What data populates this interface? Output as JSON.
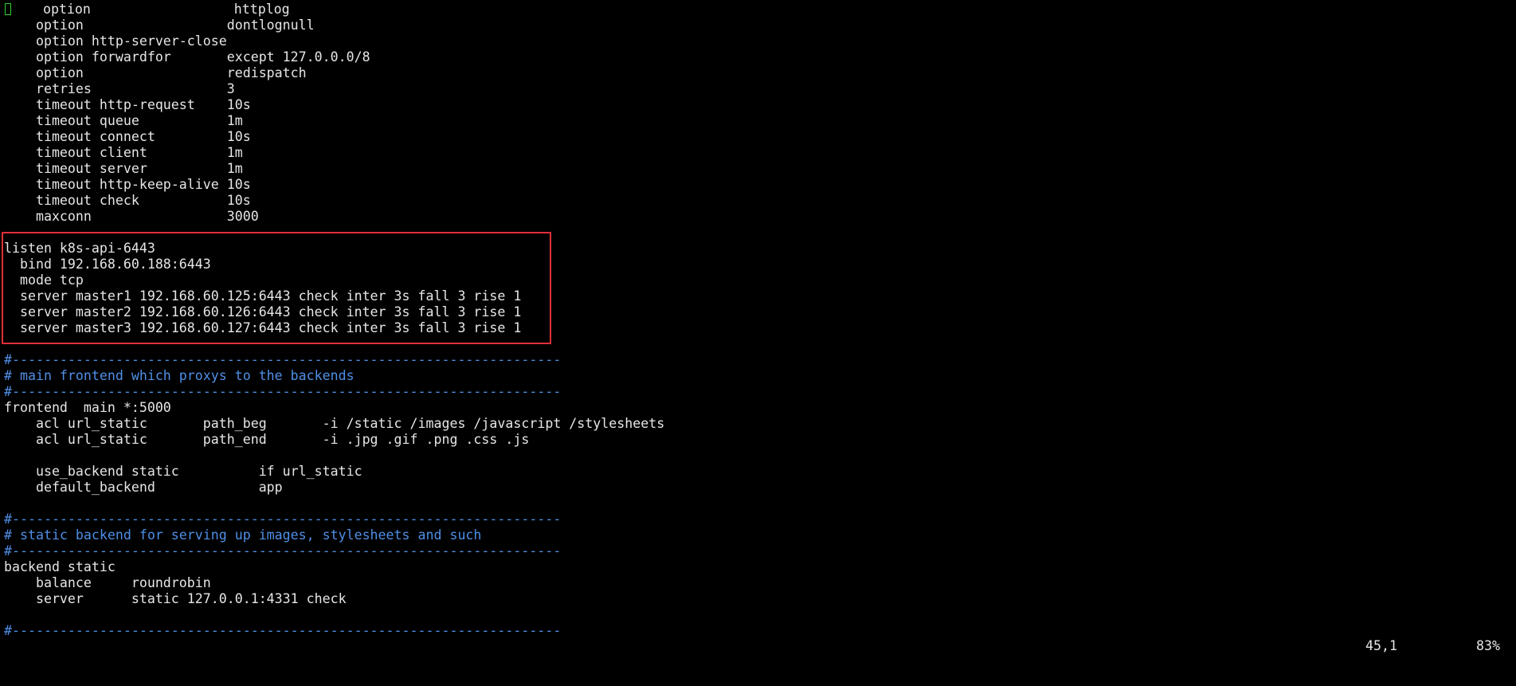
{
  "editor": {
    "cursor_color": "#2fd42f",
    "highlight_color": "#e0303a",
    "comment_color": "#4f8fe6",
    "text_color": "#e6e6e6",
    "background_color": "#000000",
    "lines": [
      "    option                  httplog",
      "    option                  dontlognull",
      "    option http-server-close",
      "    option forwardfor       except 127.0.0.0/8",
      "    option                  redispatch",
      "    retries                 3",
      "    timeout http-request    10s",
      "    timeout queue           1m",
      "    timeout connect         10s",
      "    timeout client          1m",
      "    timeout server          1m",
      "    timeout http-keep-alive 10s",
      "    timeout check           10s",
      "    maxconn                 3000",
      "",
      "listen k8s-api-6443",
      "  bind 192.168.60.188:6443",
      "  mode tcp",
      "  server master1 192.168.60.125:6443 check inter 3s fall 3 rise 1",
      "  server master2 192.168.60.126:6443 check inter 3s fall 3 rise 1",
      "  server master3 192.168.60.127:6443 check inter 3s fall 3 rise 1",
      "",
      "#---------------------------------------------------------------------",
      "# main frontend which proxys to the backends",
      "#---------------------------------------------------------------------",
      "frontend  main *:5000",
      "    acl url_static       path_beg       -i /static /images /javascript /stylesheets",
      "    acl url_static       path_end       -i .jpg .gif .png .css .js",
      "",
      "    use_backend static          if url_static",
      "    default_backend             app",
      "",
      "#---------------------------------------------------------------------",
      "# static backend for serving up images, stylesheets and such",
      "#---------------------------------------------------------------------",
      "backend static",
      "    balance     roundrobin",
      "    server      static 127.0.0.1:4331 check",
      "",
      "#---------------------------------------------------------------------"
    ]
  },
  "status": {
    "position": "45,1",
    "percent": "83%"
  }
}
